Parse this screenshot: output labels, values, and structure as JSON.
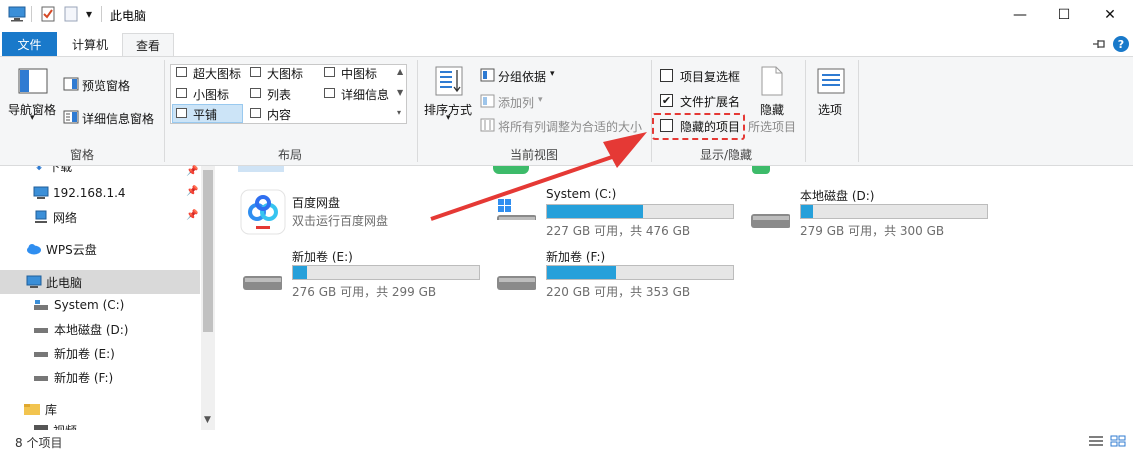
{
  "window": {
    "title": "此电脑",
    "minimize": "—",
    "maximize": "☐",
    "close": "✕",
    "qat_dropdown": "▾"
  },
  "tabs": {
    "file": "文件",
    "computer": "计算机",
    "view": "查看"
  },
  "ribbon": {
    "panes": {
      "nav_pane": "导航窗格",
      "preview_pane": "预览窗格",
      "details_pane": "详细信息窗格",
      "group": "窗格"
    },
    "layout": {
      "extra_large": "超大图标",
      "large": "大图标",
      "medium": "中图标",
      "small": "小图标",
      "list": "列表",
      "details": "详细信息",
      "tiles": "平铺",
      "content": "内容",
      "group": "布局"
    },
    "current_view": {
      "sort_by": "排序方式",
      "group_by": "分组依据",
      "add_column": "添加列",
      "fit_columns": "将所有列调整为合适的大小",
      "group": "当前视图"
    },
    "show_hide": {
      "item_checkboxes": "项目复选框",
      "file_extensions": "文件扩展名",
      "hidden_items": "隐藏的项目",
      "hide_selected": "隐藏",
      "hide_selected_2": "所选项目",
      "group": "显示/隐藏"
    },
    "options": "选项"
  },
  "nav": {
    "items": [
      {
        "label": "下载"
      },
      {
        "label": "192.168.1.4"
      },
      {
        "label": "网络"
      },
      {
        "label": "WPS云盘"
      },
      {
        "label": "此电脑"
      },
      {
        "label": "System (C:)"
      },
      {
        "label": "本地磁盘 (D:)"
      },
      {
        "label": "新加卷 (E:)"
      },
      {
        "label": "新加卷 (F:)"
      },
      {
        "label": "库"
      },
      {
        "label": "视频"
      }
    ]
  },
  "content": {
    "tiles": [
      {
        "name": "百度网盘",
        "sub": "双击运行百度网盘"
      },
      {
        "name": "System (C:)",
        "sub": "227 GB 可用，共 476 GB",
        "used": 0.523
      },
      {
        "name": "本地磁盘 (D:)",
        "sub": "279 GB 可用，共 300 GB",
        "used": 0.07
      },
      {
        "name": "新加卷 (E:)",
        "sub": "276 GB 可用，共 299 GB",
        "used": 0.077
      },
      {
        "name": "新加卷 (F:)",
        "sub": "220 GB 可用，共 353 GB",
        "used": 0.377
      }
    ]
  },
  "status": {
    "count": "8 个项目"
  },
  "colors": {
    "accent": "#1979ca",
    "drive_fill": "#26a0da",
    "annotation": "#e53935"
  }
}
